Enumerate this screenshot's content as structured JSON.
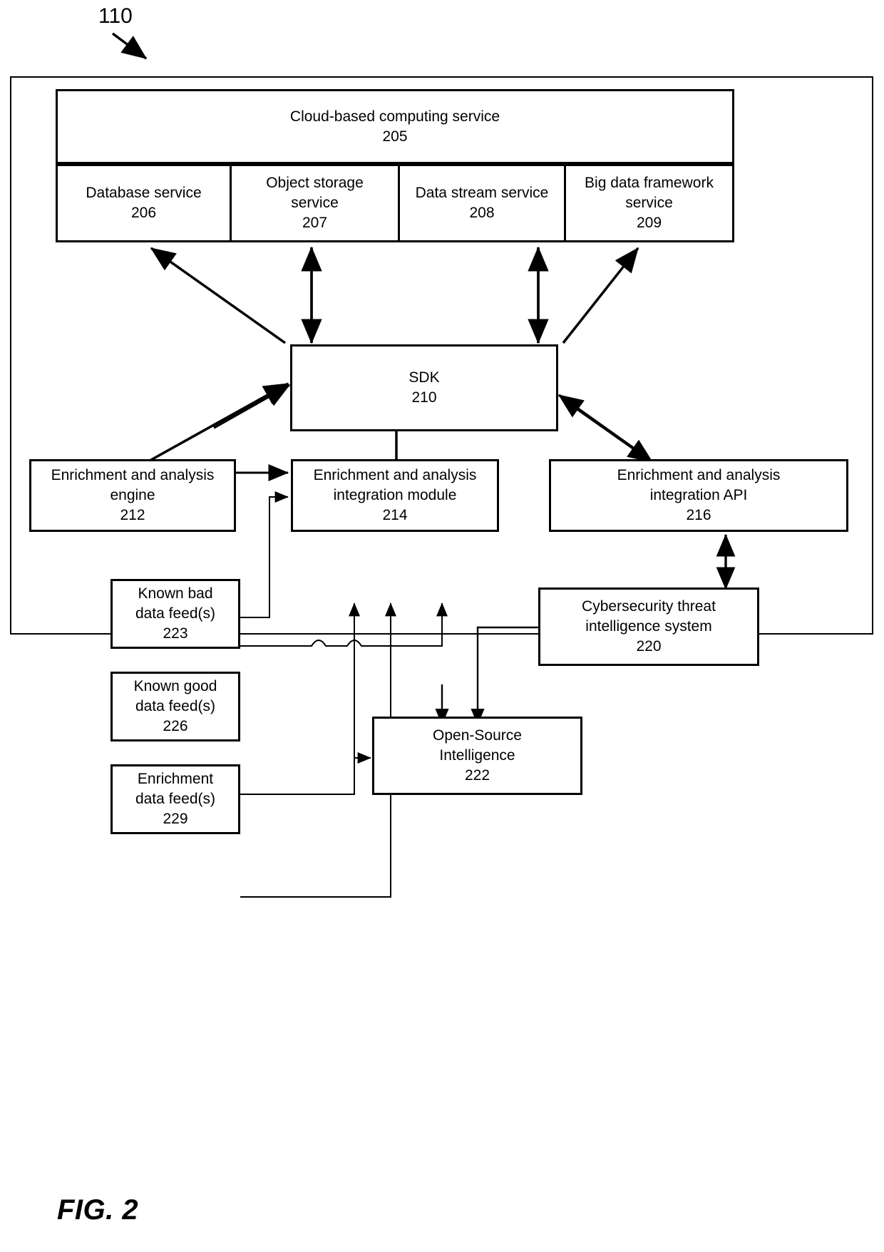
{
  "figure": {
    "label": "FIG. 2",
    "reference_numeral": "110"
  },
  "outer_system": {
    "name": "system-boundary"
  },
  "cloud": {
    "title": "Cloud-based computing service",
    "number": "205",
    "services": [
      {
        "line1": "Database service",
        "line2": "",
        "number": "206"
      },
      {
        "line1": "Object storage",
        "line2": "service",
        "number": "207"
      },
      {
        "line1": "Data stream service",
        "line2": "",
        "number": "208"
      },
      {
        "line1": "Big data framework",
        "line2": "service",
        "number": "209"
      }
    ]
  },
  "sdk": {
    "title": "SDK",
    "number": "210"
  },
  "middle_row": [
    {
      "line1": "Enrichment and analysis",
      "line2": "engine",
      "number": "212"
    },
    {
      "line1": "Enrichment and analysis",
      "line2": "integration module",
      "number": "214"
    },
    {
      "line1": "Enrichment and analysis",
      "line2": "integration API",
      "number": "216"
    }
  ],
  "feeds": [
    {
      "line1": "Known bad",
      "line2": "data feed(s)",
      "number": "223"
    },
    {
      "line1": "Known good",
      "line2": "data feed(s)",
      "number": "226"
    },
    {
      "line1": "Enrichment",
      "line2": "data feed(s)",
      "number": "229"
    }
  ],
  "external": [
    {
      "line1": "Cybersecurity threat",
      "line2": "intelligence system",
      "number": "220"
    },
    {
      "line1": "Open-Source",
      "line2": "Intelligence",
      "number": "222"
    }
  ]
}
